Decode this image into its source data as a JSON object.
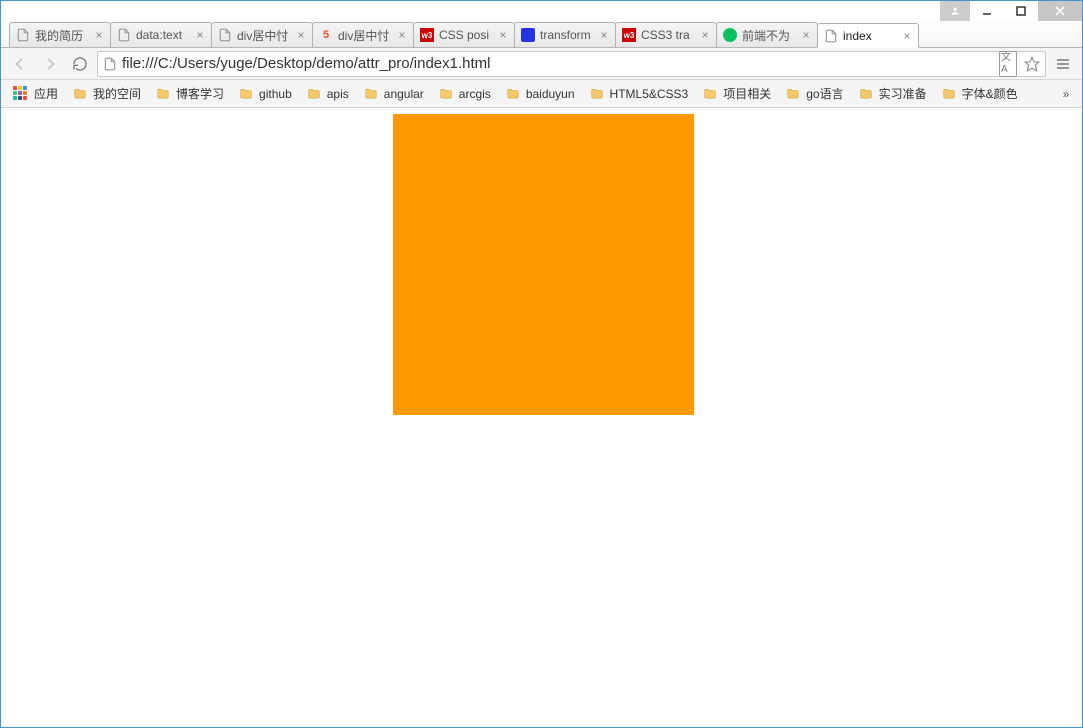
{
  "window": {
    "tabs": [
      {
        "label": "我的简历",
        "icon": "page"
      },
      {
        "label": "data:text",
        "icon": "page"
      },
      {
        "label": "div居中忖",
        "icon": "page"
      },
      {
        "label": "div居中忖",
        "icon": "h5"
      },
      {
        "label": "CSS posi",
        "icon": "w3"
      },
      {
        "label": "transform",
        "icon": "baidu"
      },
      {
        "label": "CSS3 tra",
        "icon": "w3"
      },
      {
        "label": "前端不为",
        "icon": "wechat"
      },
      {
        "label": "index",
        "icon": "page",
        "active": true
      }
    ],
    "url": "file:///C:/Users/yuge/Desktop/demo/attr_pro/index1.html"
  },
  "bookmarks": {
    "apps_label": "应用",
    "items": [
      "我的空间",
      "博客学习",
      "github",
      "apis",
      "angular",
      "arcgis",
      "baiduyun",
      "HTML5&CSS3",
      "项目相关",
      "go语言",
      "实习准备",
      "字体&颜色"
    ]
  },
  "content": {
    "box_color": "#ff9900"
  }
}
